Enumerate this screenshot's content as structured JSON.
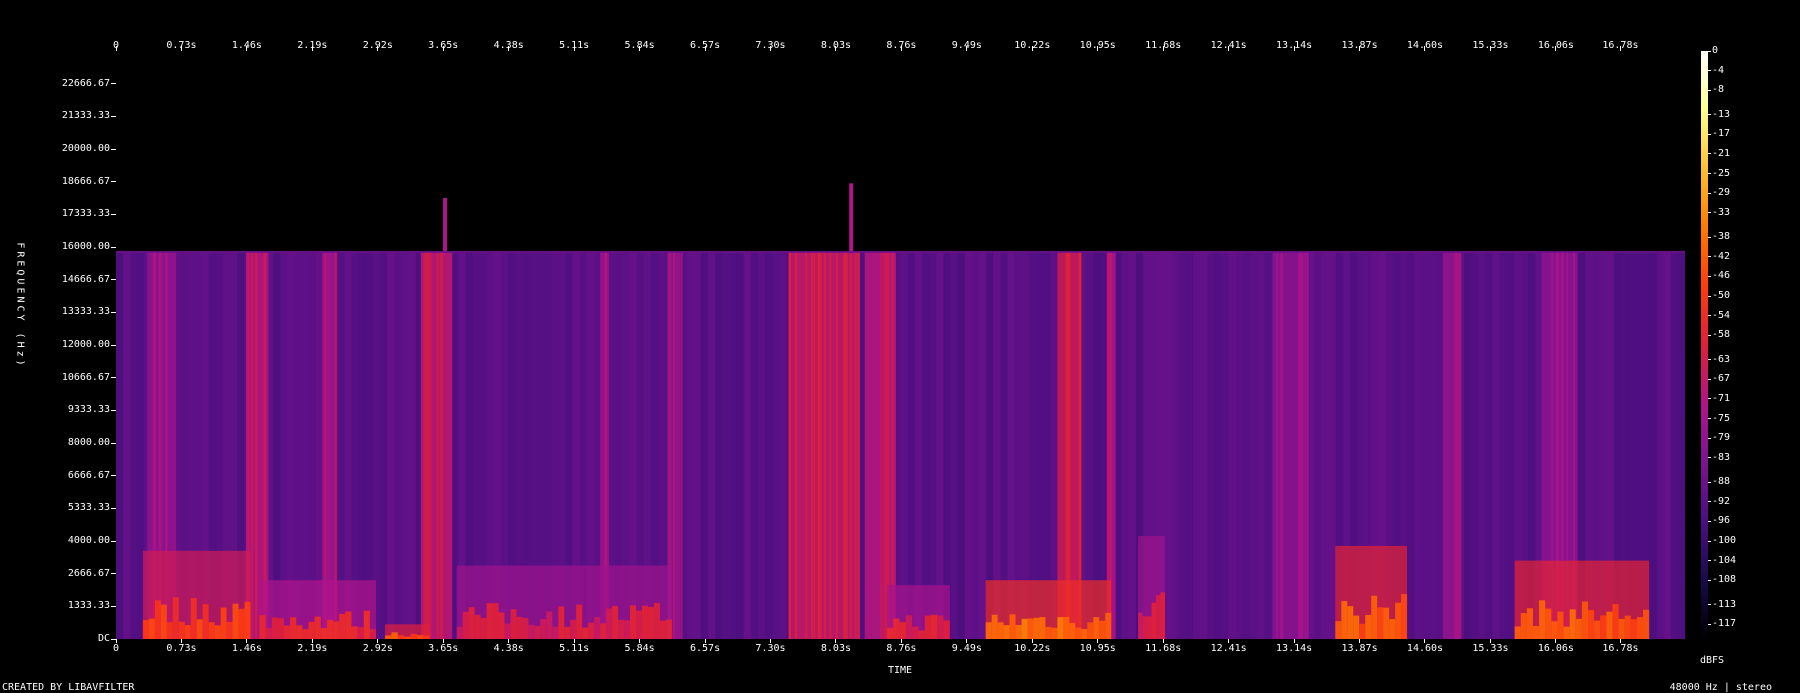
{
  "chart_data": {
    "type": "heatmap",
    "title": "",
    "xlabel": "TIME",
    "ylabel": "FREQUENCY (Hz)",
    "colorbar_label": "dBFS",
    "footer_left": "CREATED BY LIBAVFILTER",
    "footer_right": "48000 Hz | stereo",
    "sample_rate_hz": 48000,
    "channels": "stereo",
    "x_ticks": [
      "0",
      "0.73s",
      "1.46s",
      "2.19s",
      "2.92s",
      "3.65s",
      "4.38s",
      "5.11s",
      "5.84s",
      "6.57s",
      "7.30s",
      "8.03s",
      "8.76s",
      "9.49s",
      "10.22s",
      "10.95s",
      "11.68s",
      "12.41s",
      "13.14s",
      "13.87s",
      "14.60s",
      "15.33s",
      "16.06s",
      "16.78s"
    ],
    "x_tick_values": [
      0,
      0.73,
      1.46,
      2.19,
      2.92,
      3.65,
      4.38,
      5.11,
      5.84,
      6.57,
      7.3,
      8.03,
      8.76,
      9.49,
      10.22,
      10.95,
      11.68,
      12.41,
      13.14,
      13.87,
      14.6,
      15.33,
      16.06,
      16.78
    ],
    "xlim": [
      0,
      17.5
    ],
    "y_ticks": [
      "22666.67",
      "21333.33",
      "20000.00",
      "18666.67",
      "17333.33",
      "16000.00",
      "14666.67",
      "13333.33",
      "12000.00",
      "10666.67",
      "9333.33",
      "8000.00",
      "6666.67",
      "5333.33",
      "4000.00",
      "2666.67",
      "1333.33",
      "DC"
    ],
    "y_tick_values": [
      22666.67,
      21333.33,
      20000,
      18666.67,
      17333.33,
      16000,
      14666.67,
      13333.33,
      12000,
      10666.67,
      9333.33,
      8000,
      6666.67,
      5333.33,
      4000,
      2666.67,
      1333.33,
      0
    ],
    "ylim": [
      0,
      24000
    ],
    "colorbar_ticks": [
      "0",
      "-4",
      "-8",
      "-13",
      "-17",
      "-21",
      "-25",
      "-29",
      "-33",
      "-38",
      "-42",
      "-46",
      "-50",
      "-54",
      "-58",
      "-63",
      "-67",
      "-71",
      "-75",
      "-79",
      "-83",
      "-88",
      "-92",
      "-96",
      "-100",
      "-104",
      "-108",
      "-113",
      "-117"
    ],
    "colorbar_tick_values": [
      0,
      -4,
      -8,
      -13,
      -17,
      -21,
      -25,
      -29,
      -33,
      -38,
      -42,
      -46,
      -50,
      -54,
      -58,
      -63,
      -67,
      -71,
      -75,
      -79,
      -83,
      -88,
      -92,
      -96,
      -100,
      -104,
      -108,
      -113,
      -117
    ],
    "zlim": [
      -120,
      0
    ],
    "colormap": [
      "#000000",
      "#1a0a4a",
      "#4a0f80",
      "#7a1490",
      "#b0148a",
      "#e01f3a",
      "#ff3a10",
      "#ff7a00",
      "#ffc030",
      "#ffff90",
      "#ffffff"
    ],
    "background_level_dbfs": -92,
    "lowpass_cutoff_hz": 15800,
    "bursts": [
      {
        "t0": 0.35,
        "t1": 0.65,
        "level": -78
      },
      {
        "t0": 1.45,
        "t1": 1.7,
        "level": -70
      },
      {
        "t0": 2.3,
        "t1": 2.45,
        "level": -74
      },
      {
        "t0": 3.4,
        "t1": 3.75,
        "level": -68
      },
      {
        "t0": 5.4,
        "t1": 5.5,
        "level": -76
      },
      {
        "t0": 6.15,
        "t1": 6.3,
        "level": -76
      },
      {
        "t0": 7.5,
        "t1": 8.3,
        "level": -66
      },
      {
        "t0": 8.35,
        "t1": 8.7,
        "level": -70
      },
      {
        "t0": 10.5,
        "t1": 10.75,
        "level": -64
      },
      {
        "t0": 11.05,
        "t1": 11.15,
        "level": -72
      },
      {
        "t0": 12.9,
        "t1": 13.3,
        "level": -80
      },
      {
        "t0": 14.8,
        "t1": 15.0,
        "level": -78
      },
      {
        "t0": 15.9,
        "t1": 16.3,
        "level": -80
      }
    ],
    "spikes": [
      {
        "t": 3.67,
        "f_top": 18000,
        "level": -72
      },
      {
        "t": 8.2,
        "f_top": 18600,
        "level": -72
      }
    ],
    "low_freq_activity": [
      {
        "t0": 0.3,
        "t1": 1.5,
        "f_max": 3600,
        "level": -50
      },
      {
        "t0": 1.6,
        "t1": 2.9,
        "f_max": 2400,
        "level": -58
      },
      {
        "t0": 3.0,
        "t1": 3.5,
        "f_max": 600,
        "level": -46
      },
      {
        "t0": 3.8,
        "t1": 6.2,
        "f_max": 3000,
        "level": -62
      },
      {
        "t0": 8.6,
        "t1": 9.3,
        "f_max": 2200,
        "level": -60
      },
      {
        "t0": 9.7,
        "t1": 11.1,
        "f_max": 2400,
        "level": -40
      },
      {
        "t0": 11.4,
        "t1": 11.7,
        "f_max": 4200,
        "level": -62
      },
      {
        "t0": 13.6,
        "t1": 14.4,
        "f_max": 3800,
        "level": -44
      },
      {
        "t0": 15.6,
        "t1": 17.1,
        "f_max": 3200,
        "level": -44
      }
    ]
  }
}
